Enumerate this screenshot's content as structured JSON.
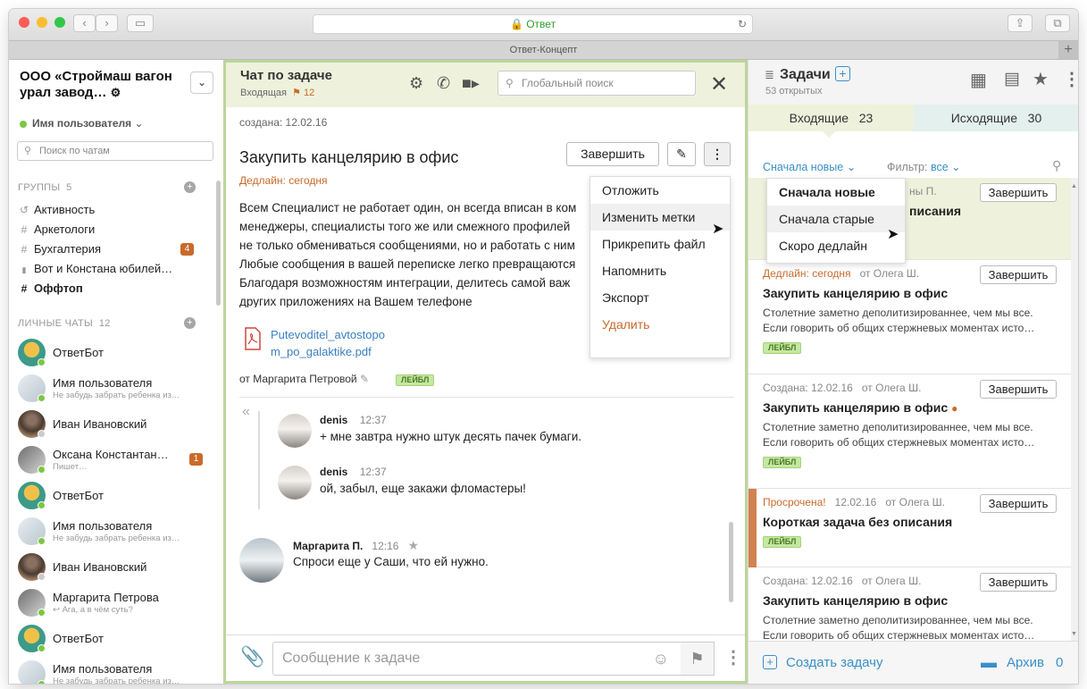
{
  "browser": {
    "url": "Ответ",
    "tab": "Ответ-Концепт",
    "colors": {
      "close": "#fc5c54",
      "minimize": "#fdbc2e",
      "maximize": "#33c748"
    }
  },
  "sidebar": {
    "org": "ООО «Строймаш вагон урал завод…",
    "user": "Имя пользователя",
    "search_placeholder": "Поиск по чатам",
    "groups_label": "ГРУППЫ",
    "groups_count": "5",
    "groups": [
      {
        "icon": "history-icon",
        "glyph": "↺",
        "label": "Активность"
      },
      {
        "icon": "hash-icon",
        "glyph": "#",
        "label": "Аркетологи"
      },
      {
        "icon": "hash-icon",
        "glyph": "#",
        "label": "Бухгалтерия",
        "badge": "4"
      },
      {
        "icon": "lock-icon",
        "glyph": "🔒",
        "label": "Вот и Констана юбилей…"
      },
      {
        "icon": "hash-icon",
        "glyph": "#",
        "label": "Оффтоп"
      }
    ],
    "personal_label": "ЛИЧНЫЕ ЧАТЫ",
    "personal_count": "12",
    "chats": [
      {
        "name": "ОтветБот",
        "sub": ""
      },
      {
        "name": "Имя пользователя",
        "sub": "Не забудь забрать ребенка из…"
      },
      {
        "name": "Иван Ивановский",
        "sub": ""
      },
      {
        "name": "Оксана Константан…",
        "sub": "Пишет…",
        "badge": "1"
      },
      {
        "name": "ОтветБот",
        "sub": ""
      },
      {
        "name": "Имя пользователя",
        "sub": "Не забудь забрать ребенка из…"
      },
      {
        "name": "Иван Ивановский",
        "sub": ""
      },
      {
        "name": "Маргарита Петрова",
        "sub": "↩ Ага, а в чём суть?"
      },
      {
        "name": "ОтветБот",
        "sub": ""
      },
      {
        "name": "Имя пользователя",
        "sub": "Не забудь забрать ребенка из…"
      }
    ]
  },
  "chat": {
    "title": "Чат по задаче",
    "subtitle": "Входящая",
    "flag_count": "12",
    "search_placeholder": "Глобальный поиск",
    "created": "создана: 12.02.16",
    "task_title": "Закупить канцелярию в офис",
    "complete_label": "Завершить",
    "deadline": "Дедлайн: сегодня",
    "body": "Всем Специалист не работает один, он всегда вписан в ком\nменеджеры, специалисты того же или смежного профилей\nне только обмениваться сообщениями, но и работать с ним\nЛюбые сообщения в вашей переписке легко превращаются\nБлагодаря возможностям интеграции, делитесь самой важ\nдругих приложениях на Вашем телефоне",
    "file_line1": "Putevoditel_avtostopo",
    "file_line2": "m_po_galaktike.pdf",
    "from": "от Маргарита Петровой",
    "label": "ЛЕЙБЛ",
    "menu": [
      "Отложить",
      "Изменить метки",
      "Прикрепить файл",
      "Напомнить",
      "Экспорт",
      "Удалить"
    ],
    "quote_glyph": "«",
    "messages": [
      {
        "author": "denis",
        "time": "12:37",
        "text": "+ мне завтра нужно штук десять пачек бумаги."
      },
      {
        "author": "denis",
        "time": "12:37",
        "text": "ой, забыл, еще закажи фломастеры!"
      },
      {
        "author": "Маргарита П.",
        "time": "12:16",
        "text": "Спроси еще у Саши, что ей нужно."
      }
    ],
    "composer_placeholder": "Сообщение к задаче"
  },
  "tasks": {
    "title": "Задачи",
    "open": "53 открытых",
    "incoming_label": "Входящие",
    "incoming_count": "23",
    "outgoing_label": "Исходящие",
    "outgoing_count": "30",
    "sort": "Сначала новые ⌄",
    "filter_label": "Фильтр:",
    "filter_value": "все ⌄",
    "sort_options": [
      "Сначала новые",
      "Сначала старые",
      "Скоро дедлайн"
    ],
    "card0": {
      "meta_tail": "ны П.",
      "title_tail": "писания",
      "button": "Завершить"
    },
    "cards": [
      {
        "meta1": "Дедлайн: сегодня",
        "meta2": "от Олега Ш.",
        "title": "Закупить канцелярию в офис",
        "desc": "Столетние заметно деполитизированнее, чем мы все. Если говорить об общих стержневых моментах исто…",
        "label": "ЛЕЙБЛ",
        "button": "Завершить"
      },
      {
        "meta1": "Создана: 12.02.16",
        "meta2": "от Олега Ш.",
        "title": "Закупить канцелярию в офис",
        "desc": "Столетние заметно деполитизированнее, чем мы все. Если говорить об общих стержневых моментах исто…",
        "label": "ЛЕЙБЛ",
        "button": "Завершить"
      },
      {
        "meta1": "Просрочена!",
        "meta1b": "12.02.16",
        "meta2": "от Олега Ш.",
        "title": "Короткая задача без описания",
        "desc": "",
        "label": "ЛЕЙБЛ",
        "button": "Завершить"
      },
      {
        "meta1": "Создана: 12.02.16",
        "meta2": "от Олега Ш.",
        "title": "Закупить канцелярию в офис",
        "desc": "Столетние заметно деполитизированнее, чем мы все. Если говорить об общих стержневых моментах исто…",
        "button": "Завершить"
      }
    ],
    "create": "Создать задачу",
    "archive": "Архив",
    "archive_count": "0"
  }
}
